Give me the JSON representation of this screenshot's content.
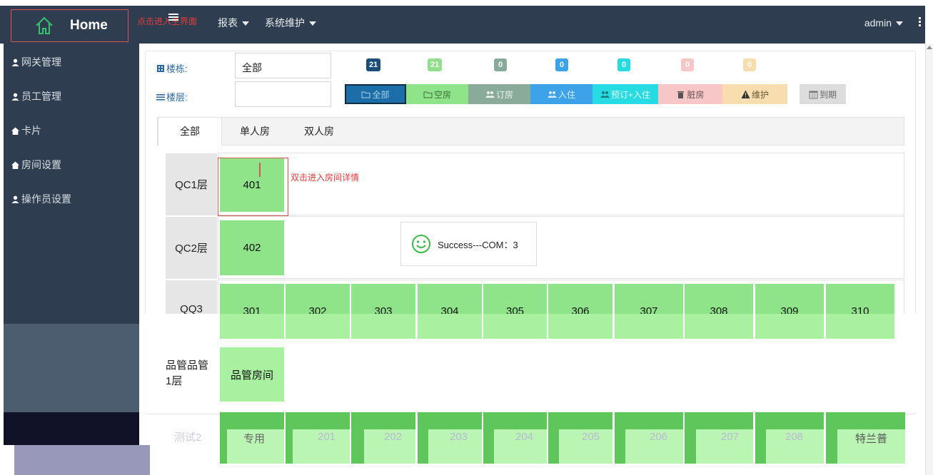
{
  "header": {
    "home_label": "Home",
    "enter_hint": "点击进入主界面",
    "menus": [
      {
        "label": "报表"
      },
      {
        "label": "系统维护"
      }
    ],
    "user": "admin"
  },
  "sidebar": {
    "items": [
      {
        "label": "网关管理",
        "icon": "user-icon"
      },
      {
        "label": "员工管理",
        "icon": "user-icon"
      },
      {
        "label": "卡片",
        "icon": "home-icon"
      },
      {
        "label": "房间设置",
        "icon": "home-icon"
      },
      {
        "label": "操作员设置",
        "icon": "user-icon"
      }
    ]
  },
  "filters": {
    "building_label": "楼栋:",
    "building_value": "全部",
    "floor_label": "楼层:",
    "floor_value": ""
  },
  "status_counts": [
    "21",
    "21",
    "0",
    "0",
    "0",
    "0",
    "0"
  ],
  "status_buttons": [
    {
      "label": "全部",
      "icon": "folder-icon",
      "color": "#1b6ea8"
    },
    {
      "label": "空房",
      "icon": "folder-icon",
      "color": "#8fe48a"
    },
    {
      "label": "订房",
      "icon": "users-icon",
      "color": "#8aaa9a"
    },
    {
      "label": "入住",
      "icon": "users-icon",
      "color": "#3da3e8"
    },
    {
      "label": "预订+入住",
      "icon": "users-icon",
      "color": "#27dbe3"
    },
    {
      "label": "脏房",
      "icon": "trash-icon",
      "color": "#f7c6c6"
    },
    {
      "label": "维护",
      "icon": "warning-icon",
      "color": "#f8deaf"
    },
    {
      "label": "到期",
      "icon": "calendar-icon",
      "color": "#dddddd"
    }
  ],
  "tabs": [
    "全部",
    "单人房",
    "双人房"
  ],
  "hint_double_click": "双击进入房间详情",
  "toast": {
    "text": "Success---COM：3",
    "icon": "smile-icon"
  },
  "floors": [
    {
      "name": "QC1层",
      "rooms": [
        "401"
      ]
    },
    {
      "name": "QC2层",
      "rooms": [
        "402"
      ]
    },
    {
      "name": "QQ3",
      "rooms": [
        "301",
        "302",
        "303",
        "304",
        "305",
        "306",
        "307",
        "308",
        "309",
        "310"
      ]
    },
    {
      "name": "品管品管1层",
      "rooms": [
        "品管房间"
      ]
    },
    {
      "name": "测试2",
      "rooms": [
        "专用",
        "201",
        "202",
        "203",
        "204",
        "205",
        "206",
        "207",
        "208",
        "特兰普"
      ]
    }
  ]
}
